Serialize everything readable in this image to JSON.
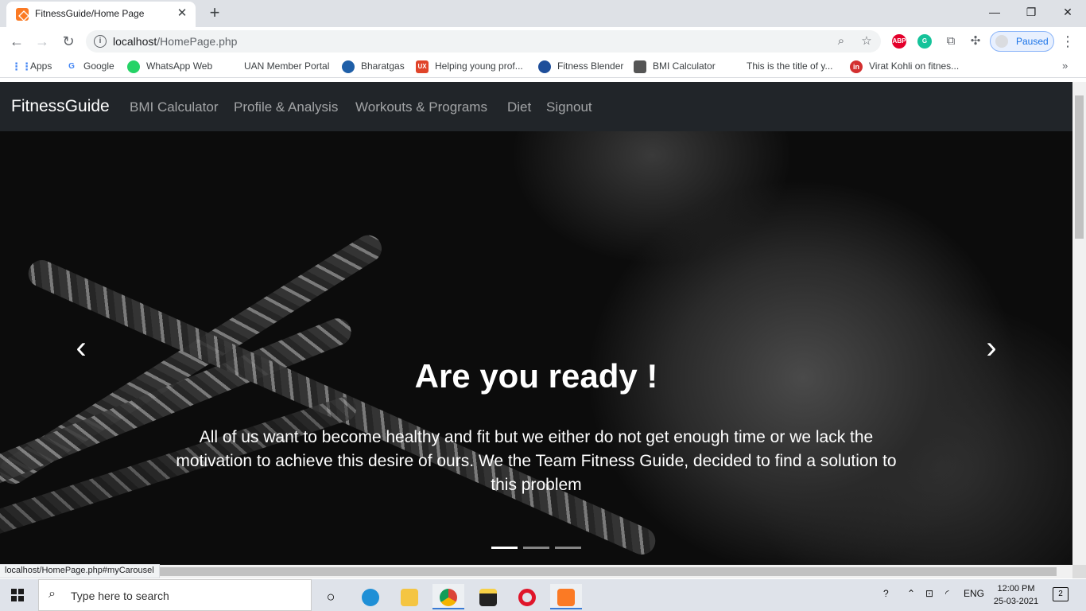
{
  "browser": {
    "tab_title": "FitnessGuide/Home Page",
    "tab_close": "✕",
    "new_tab": "+",
    "win_min": "—",
    "win_max": "❐",
    "win_close": "✕",
    "url_host": "localhost",
    "url_path": "/HomePage.php",
    "profile_status": "Paused",
    "extensions": [
      {
        "name": "ABP",
        "color": "#e4002b"
      },
      {
        "name": "G",
        "color": "#15c39a"
      }
    ]
  },
  "bookmarks": [
    {
      "label": "Apps",
      "icon": "apps-grid-icon",
      "color": "#4285f4"
    },
    {
      "label": "Google",
      "icon": "google-icon",
      "color": "#4285f4"
    },
    {
      "label": "WhatsApp Web",
      "icon": "whatsapp-icon",
      "color": "#25d366"
    },
    {
      "label": "UAN Member Portal",
      "icon": "blank-page-icon",
      "color": "#ffffff"
    },
    {
      "label": "Bharatgas",
      "icon": "bharatgas-icon",
      "color": "#1f5fa8"
    },
    {
      "label": "Helping young prof...",
      "icon": "ux-icon",
      "color": "#e0442a"
    },
    {
      "label": "Fitness Blender",
      "icon": "fitness-blender-icon",
      "color": "#1e4e9a"
    },
    {
      "label": "BMI Calculator",
      "icon": "calculator-icon",
      "color": "#555555"
    },
    {
      "label": "This is the title of y...",
      "icon": "blank-page-icon",
      "color": "#ffffff"
    },
    {
      "label": "Virat Kohli on fitnes...",
      "icon": "in-icon",
      "color": "#d32f2f"
    }
  ],
  "site": {
    "brand": "FitnessGuide",
    "nav": [
      "BMI Calculator",
      "Profile & Analysis",
      "Workouts & Programs",
      "Diet",
      "Signout"
    ],
    "carousel": {
      "title": "Are you ready !",
      "text": "All of us want to become healthy and fit but we either do not get enough time or we lack the motivation to achieve this desire of ours. We the Team Fitness Guide, decided to find a solution to this problem",
      "prev": "‹",
      "next": "›",
      "slide_count": 3,
      "active_slide": 1
    }
  },
  "status_bar": "localhost/HomePage.php#myCarousel",
  "taskbar": {
    "search_placeholder": "Type here to search",
    "language": "ENG",
    "time": "12:00 PM",
    "date": "25-03-2021",
    "notification_count": "2"
  }
}
